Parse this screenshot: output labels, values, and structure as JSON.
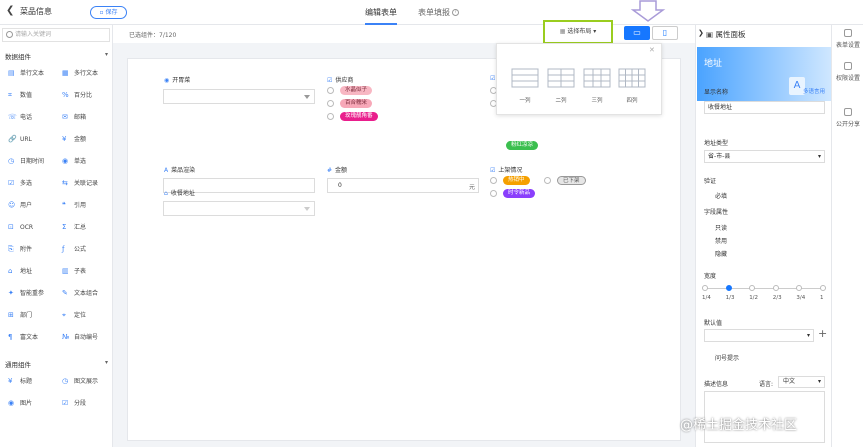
{
  "header": {
    "title": "菜品信息",
    "save_label": "保存",
    "tabs": [
      {
        "label": "编辑表单",
        "active": true
      },
      {
        "label": "表单填报",
        "active": false
      }
    ]
  },
  "left_panel": {
    "search_placeholder": "请输入关键词",
    "sections": [
      {
        "label": "数据组件",
        "items": [
          {
            "label": "单行文本",
            "icon": "text-line-icon"
          },
          {
            "label": "多行文本",
            "icon": "text-multiline-icon"
          },
          {
            "label": "数值",
            "icon": "number-icon"
          },
          {
            "label": "百分比",
            "icon": "percent-icon"
          },
          {
            "label": "电话",
            "icon": "phone-icon"
          },
          {
            "label": "邮箱",
            "icon": "mail-icon"
          },
          {
            "label": "URL",
            "icon": "link-icon"
          },
          {
            "label": "金额",
            "icon": "money-icon"
          },
          {
            "label": "日期时间",
            "icon": "clock-icon"
          },
          {
            "label": "单选",
            "icon": "radio-icon"
          },
          {
            "label": "多选",
            "icon": "checkbox-icon"
          },
          {
            "label": "关联记录",
            "icon": "relation-icon"
          },
          {
            "label": "用户",
            "icon": "user-icon"
          },
          {
            "label": "引用",
            "icon": "quote-icon"
          },
          {
            "label": "OCR",
            "icon": "ocr-icon"
          },
          {
            "label": "汇总",
            "icon": "sum-icon"
          },
          {
            "label": "附件",
            "icon": "attachment-icon"
          },
          {
            "label": "公式",
            "icon": "formula-icon"
          },
          {
            "label": "地址",
            "icon": "address-icon"
          },
          {
            "label": "子表",
            "icon": "subtable-icon"
          },
          {
            "label": "智能重参",
            "icon": "smart-icon"
          },
          {
            "label": "文本组合",
            "icon": "text-combine-icon"
          },
          {
            "label": "部门",
            "icon": "department-icon"
          },
          {
            "label": "定位",
            "icon": "location-icon"
          },
          {
            "label": "富文本",
            "icon": "richtext-icon"
          },
          {
            "label": "自动编号",
            "icon": "autonumber-icon"
          }
        ]
      },
      {
        "label": "通用组件",
        "items": [
          {
            "label": "标题",
            "icon": "heading-icon"
          },
          {
            "label": "图文展示",
            "icon": "image-text-icon"
          },
          {
            "label": "图片",
            "icon": "image-icon"
          },
          {
            "label": "分段",
            "icon": "section-icon"
          }
        ]
      }
    ]
  },
  "toolbar": {
    "counter": "已选组件：7/120",
    "layout_button": "选择布局",
    "pc_icon": "desktop-icon",
    "mobile_icon": "mobile-icon"
  },
  "layout_popup": {
    "options": [
      "一列",
      "二列",
      "三列",
      "四列"
    ]
  },
  "form": {
    "fields": [
      {
        "label": "开胃菜",
        "icon": "radio-icon"
      },
      {
        "label": "供应商",
        "icon": "checkbox-icon"
      },
      {
        "label": "菜品渲染",
        "icon": "text-icon"
      },
      {
        "label": "金额",
        "icon": "hash-icon"
      },
      {
        "label": "上架情况",
        "icon": "checkbox-icon"
      },
      {
        "label": "收餐地址",
        "icon": "address-icon"
      }
    ],
    "supplier_tags": [
      "水晶似子",
      "百合糯米",
      "玫瑰靓角番"
    ],
    "supplier_extra_tag": "粉红凉凉",
    "amount_value": "0",
    "amount_unit": "元",
    "shelf_tags": [
      "热销中",
      "已下架",
      "时令新品"
    ]
  },
  "right_panel": {
    "title": "属性面板",
    "banner_title": "地址",
    "display_name_label": "显示名称",
    "multilang_link": "多语言用",
    "display_name_value": "收餐地址",
    "address_type_label": "地址类型",
    "address_type_value": "省-市-县",
    "validation_label": "验证",
    "required_label": "必填",
    "field_props_label": "字段属性",
    "props": [
      "只读",
      "禁用",
      "隐藏"
    ],
    "width_label": "宽度",
    "width_ticks": [
      "1/4",
      "1/3",
      "1/2",
      "2/3",
      "3/4",
      "1"
    ],
    "width_selected": "1/3",
    "default_label": "默认值",
    "hint_label": "问号提示",
    "desc_label": "描述信息",
    "lang_label": "语言:",
    "lang_value": "中文"
  },
  "far_right": {
    "items": [
      "表单设置",
      "权限设置",
      "公开分享"
    ]
  },
  "watermark": "@稀土掘金技术社区",
  "colors": {
    "accent": "#1677ff",
    "highlight_border": "#9acd1f",
    "tag_pink": "#f8b7c3",
    "tag_magenta": "#e91e8c",
    "tag_green": "#3bbf4f",
    "tag_orange": "#f5a000",
    "tag_gray": "#e6e6e6",
    "tag_purple": "#8a3ffc"
  }
}
